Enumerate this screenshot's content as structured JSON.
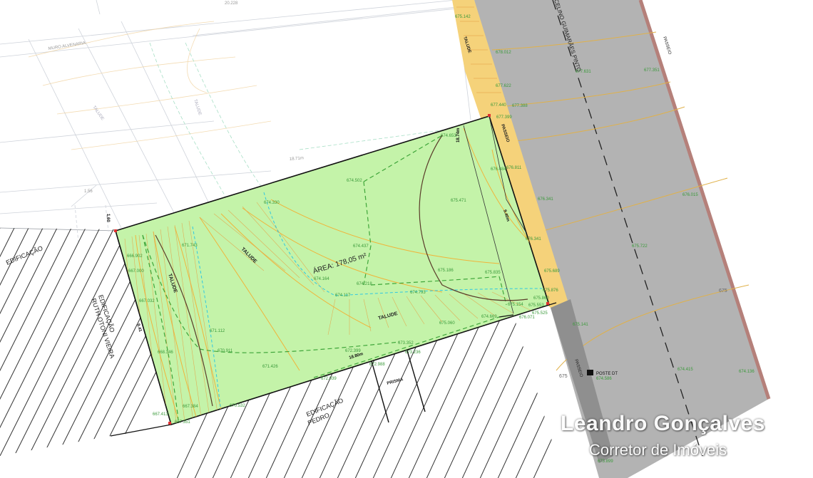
{
  "labels": {
    "area": "ÁREA: 178,05 m²",
    "talude": "TALUDE",
    "passeio": "PASSEIO",
    "prisma": "PRISMA",
    "muro_alvenaria": "MURO ALVENARIA",
    "street_name": "CELINO GUIMARÃES PINTO",
    "edificacao": "EDIFICAÇÃO",
    "edificacao_ruth_1": "EDIFICAÇÃO",
    "edificacao_ruth_2": "RUTH OTONI VIEIRA",
    "edificacao_pedro_1": "EDIFICAÇÃO",
    "edificacao_pedro_2": "PEDRO",
    "poste": "POSTE DT",
    "elev_675": "675"
  },
  "dimensions": {
    "front": "18.74m",
    "back": "18.80m",
    "left_side": "9.41",
    "right_side": "9.40m",
    "offset": "1.60",
    "offset_b": "1.56",
    "top_long": "18.71m",
    "top_road": "20.228"
  },
  "elevations": {
    "e1": "674.330",
    "e2": "674.502",
    "e3": "675.471",
    "e4": "674.437",
    "e5": "674.218",
    "e6": "674.164",
    "e7": "674.117",
    "e8": "674.793",
    "e9": "675.186",
    "e10": "675.835",
    "e11": "675.154",
    "e12": "674.669",
    "e13": "675.060",
    "e14": "671.743",
    "e15": "666.902",
    "e16": "667.000",
    "e17": "667.032",
    "e18": "671.112",
    "e19": "668.346",
    "e20": "670.911",
    "e21": "671.426",
    "e22": "672.399",
    "e23": "673.352",
    "e24": "673.236",
    "e25": "672.988",
    "e26": "672.039",
    "e27": "670.532",
    "e28": "667.384",
    "e29": "667.413",
    "e30": "667.351",
    "e31": "676.341",
    "e32": "675.689",
    "e33": "675.876",
    "e34": "675.525",
    "e35": "676.071",
    "e36": "676.484",
    "e37": "676.811",
    "e38": "677.440",
    "e39": "677.399",
    "e40": "677.388",
    "e41": "674.653",
    "e42": "676.341",
    "e43": "675.722",
    "e44": "675.141",
    "e45": "674.415",
    "e46": "674.586",
    "e47": "673.899",
    "e48": "674.136",
    "e49": "676.015",
    "e50": "677.351",
    "e51": "677.631",
    "e52": "678.012",
    "e53": "677.622",
    "e54": "675.142",
    "e55": "675.553",
    "e56": "675.860"
  },
  "watermark": {
    "name": "Leandro Gonçalves",
    "subtitle": "Corretor de Imóveis"
  },
  "colors": {
    "lot_fill": "#c4f3a9",
    "sidewalk_fill": "#f5d27a",
    "road_fill": "#b3b3b3",
    "road_edge": "#b5807a",
    "contour": "#f0b43a",
    "break_line": "#3fa63a",
    "cyan_line": "#30c8e0",
    "text_green": "#3b9a3b"
  }
}
